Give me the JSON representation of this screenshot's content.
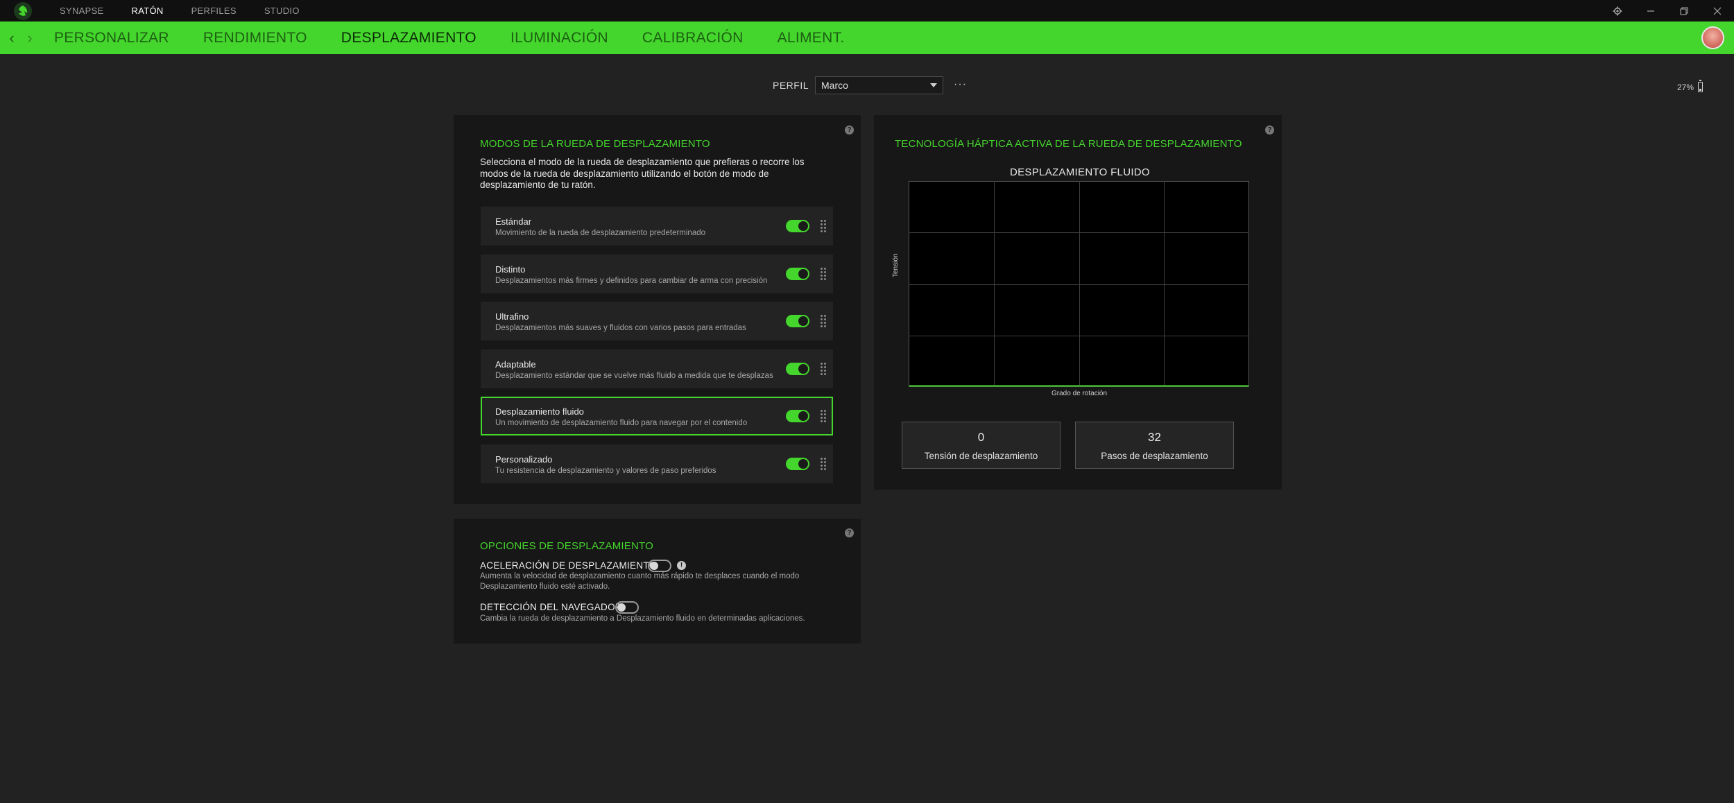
{
  "titlebar": {
    "nav": [
      "SYNAPSE",
      "RATÓN",
      "PERFILES",
      "STUDIO"
    ],
    "active_index": 1,
    "window_icons": [
      "settings-icon",
      "minimize-icon",
      "restore-icon",
      "close-icon"
    ]
  },
  "subnav": {
    "tabs": [
      "PERSONALIZAR",
      "RENDIMIENTO",
      "DESPLAZAMIENTO",
      "ILUMINACIÓN",
      "CALIBRACIÓN",
      "ALIMENT."
    ],
    "active_index": 2
  },
  "profile": {
    "label": "PERFIL",
    "selected": "Marco",
    "more": "···"
  },
  "battery": {
    "percent_text": "27%",
    "level": 0.27
  },
  "modes_panel": {
    "title": "MODOS DE LA RUEDA DE DESPLAZAMIENTO",
    "description_lines": [
      "Selecciona el modo de la rueda de desplazamiento que prefieras o recorre los",
      "modos de la rueda de desplazamiento utilizando el botón de modo de",
      "desplazamiento de tu ratón."
    ],
    "modes": [
      {
        "name": "Estándar",
        "desc": "Movimiento de la rueda de desplazamiento predeterminado",
        "enabled": true,
        "selected": false
      },
      {
        "name": "Distinto",
        "desc": "Desplazamientos más firmes y definidos para cambiar de arma con precisión",
        "enabled": true,
        "selected": false
      },
      {
        "name": "Ultrafino",
        "desc": "Desplazamientos más suaves y fluidos con varios pasos para entradas",
        "enabled": true,
        "selected": false
      },
      {
        "name": "Adaptable",
        "desc": "Desplazamiento estándar que se vuelve más fluido a medida que te desplazas",
        "enabled": true,
        "selected": false
      },
      {
        "name": "Desplazamiento fluido",
        "desc": "Un movimiento de desplazamiento fluido para navegar por el contenido",
        "enabled": true,
        "selected": true
      },
      {
        "name": "Personalizado",
        "desc": "Tu resistencia de desplazamiento y valores de paso preferidos",
        "enabled": true,
        "selected": false
      }
    ]
  },
  "haptic_panel": {
    "title": "TECNOLOGÍA HÁPTICA ACTIVA DE LA RUEDA DE DESPLAZAMIENTO",
    "tension": {
      "value": "0",
      "label": "Tensión de desplazamiento"
    },
    "steps": {
      "value": "32",
      "label": "Pasos de desplazamiento"
    }
  },
  "chart_data": {
    "type": "line",
    "title": "DESPLAZAMIENTO FLUIDO",
    "xlabel": "Grado de rotación",
    "ylabel": "Tensión",
    "x": [
      0,
      1
    ],
    "series": [
      {
        "values": [
          0,
          0
        ]
      }
    ],
    "ylim": [
      0,
      1
    ],
    "grid": true,
    "line_color": "#44d62c"
  },
  "options_panel": {
    "title": "OPCIONES DE DESPLAZAMIENTO",
    "acceleration": {
      "label": "ACELERACIÓN DE DESPLAZAMIENTO",
      "enabled": false,
      "desc_lines": [
        "Aumenta la velocidad de desplazamiento cuanto más rápido te desplaces cuando el modo",
        "Desplazamiento fluido esté activado."
      ]
    },
    "browser": {
      "label": "DETECCIÓN DEL NAVEGADOR",
      "enabled": false,
      "desc": "Cambia la rueda de desplazamiento a Desplazamiento fluido en determinadas aplicaciones."
    }
  },
  "colors": {
    "accent": "#44d62c",
    "bg": "#222222",
    "panel": "#171717"
  }
}
